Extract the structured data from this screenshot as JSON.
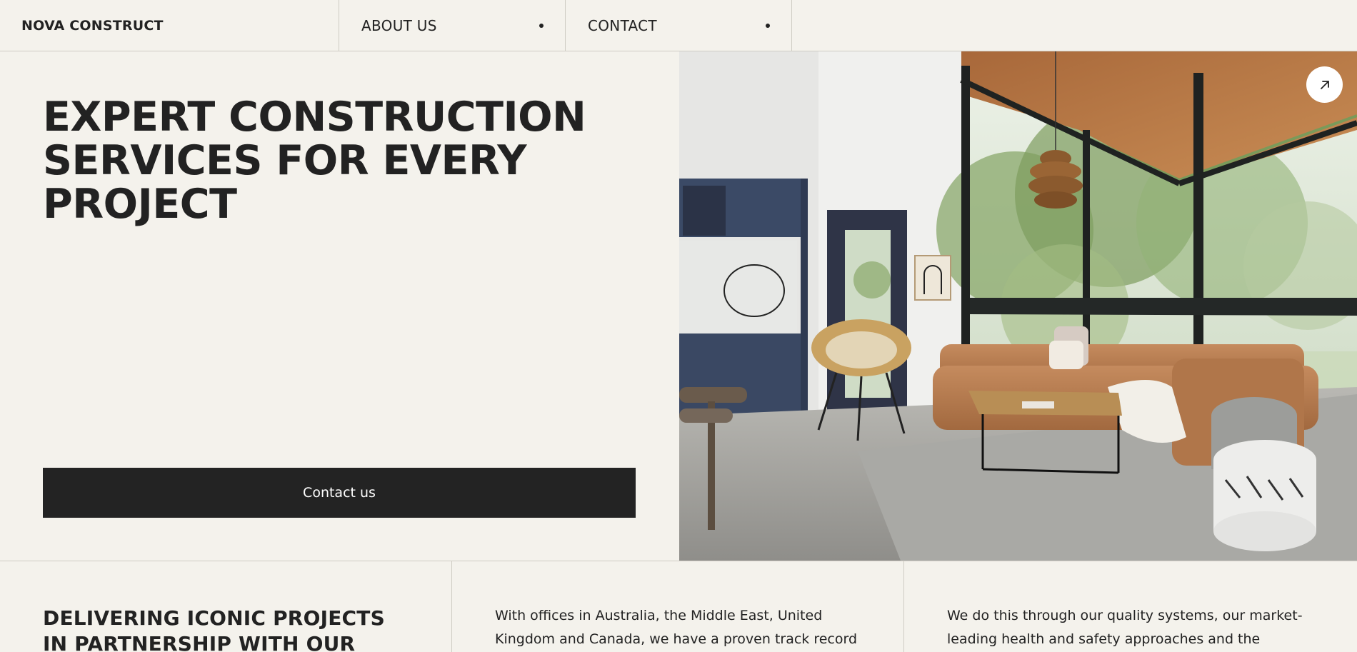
{
  "nav": {
    "brand": "NOVA CONSTRUCT",
    "items": [
      {
        "label": "ABOUT US"
      },
      {
        "label": "CONTACT"
      }
    ]
  },
  "hero": {
    "title": "EXPERT CONSTRUCTION SERVICES FOR EVERY PROJECT",
    "cta_label": "Contact us",
    "image_link_icon": "arrow-up-right-icon"
  },
  "lower": {
    "title": "DELIVERING ICONIC PROJECTS IN PARTNERSHIP WITH OUR CLIENTS",
    "col2_text": "With offices in Australia, the Middle East, United Kingdom and Canada, we have a proven track record of delivering",
    "col3_text": "We do this through our quality systems, our market-leading health and safety approaches and the positive"
  },
  "colors": {
    "background": "#f4f2ec",
    "text": "#222222",
    "button": "#232323",
    "divider": "#cfccc4"
  }
}
